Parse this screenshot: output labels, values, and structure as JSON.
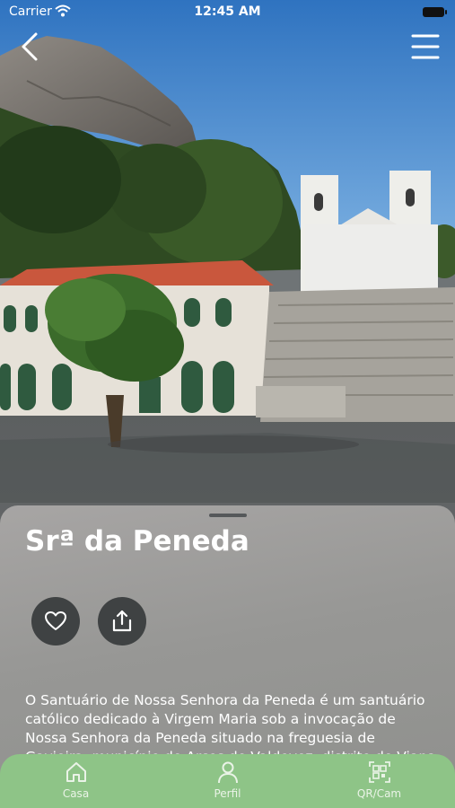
{
  "status_bar": {
    "carrier": "Carrier",
    "time": "12:45 AM"
  },
  "place": {
    "title": "Srª da Peneda",
    "description": "O Santuário de Nossa Senhora da Peneda é um santuário católico dedicado à Virgem Maria sob a invocação de Nossa Senhora da Peneda situado na freguesia de Gavieira, município de Arcos de Valdevez, distrito de Viana do Castelo."
  },
  "actions": {
    "favorite_icon": "heart-icon",
    "share_icon": "share-icon"
  },
  "tab_bar": {
    "tabs": [
      {
        "label": "Casa",
        "icon": "home-icon"
      },
      {
        "label": "Perfil",
        "icon": "user-icon"
      },
      {
        "label": "QR/Cam",
        "icon": "qr-camera-icon"
      }
    ]
  },
  "colors": {
    "tab_bar": "#8ec487",
    "sky": "#3f83c9",
    "button_dark": "#3f4243"
  }
}
